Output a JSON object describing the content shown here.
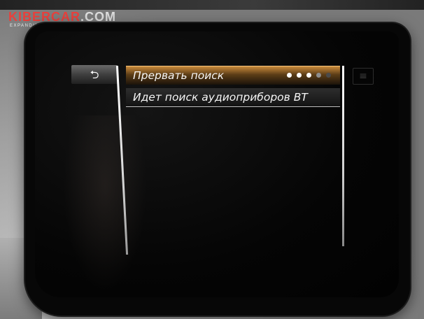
{
  "watermark": {
    "logo_brand": "KIBERCAR",
    "logo_domain": ".COM",
    "tagline": "EXPANDING POSSIBILITIES"
  },
  "screen": {
    "back_button_icon": "back-arrow-icon",
    "back_button_glyph": "⮌",
    "list_items": [
      {
        "label": "Прервать поиск",
        "selected": true,
        "progress_dots_total": 5,
        "progress_dots_active": 3
      },
      {
        "label": "Идет поиск аудиоприборов BT",
        "selected": false
      }
    ],
    "side_icon": "settings-icon",
    "side_icon_glyph": "≡"
  },
  "colors": {
    "highlight": "#c98a3a",
    "logo_red": "#e9403c",
    "text": "#f6f6f6"
  }
}
